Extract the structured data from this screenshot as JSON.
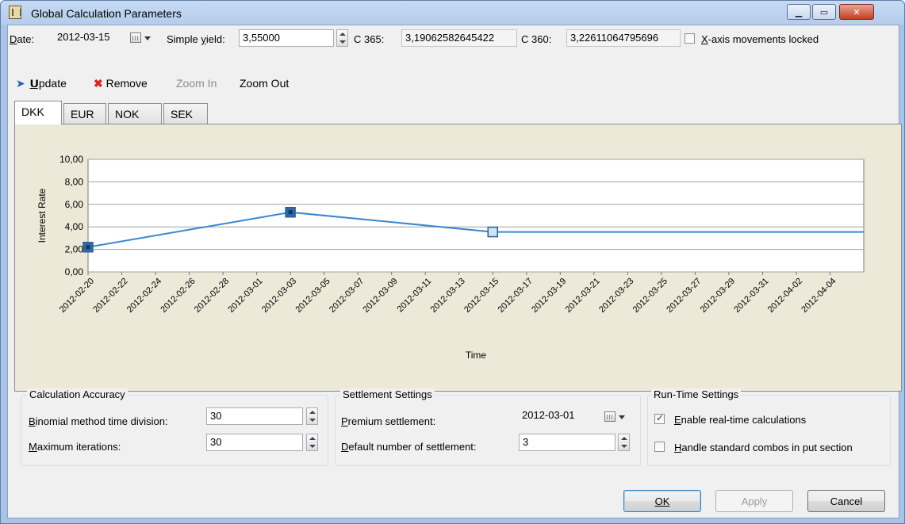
{
  "window": {
    "title": "Global Calculation Parameters"
  },
  "params": {
    "date_label": "Date:",
    "date_value": "2012-03-15",
    "simple_yield_label": "Simple yield:",
    "simple_yield_value": "3,55000",
    "c365_label": "C 365:",
    "c365_value": "3,19062582645422",
    "c360_label": "C 360:",
    "c360_value": "3,22611064795696",
    "xaxis_lock_label": "X-axis movements locked",
    "xaxis_lock_checked": false
  },
  "toolbar": {
    "update_label": "Update",
    "remove_label": "Remove",
    "zoom_in_label": "Zoom In",
    "zoom_out_label": "Zoom Out"
  },
  "tabs": [
    {
      "label": "DKK",
      "active": true
    },
    {
      "label": "EUR",
      "active": false
    },
    {
      "label": "NOK",
      "active": false
    },
    {
      "label": "SEK",
      "active": false
    }
  ],
  "chart_data": {
    "type": "line",
    "xlabel": "Time",
    "ylabel": "Interest Rate",
    "ylim": [
      0,
      10
    ],
    "y_ticks": [
      "0,00",
      "2,00",
      "4,00",
      "6,00",
      "8,00",
      "10,00"
    ],
    "x_ticks": [
      "2012-02-20",
      "2012-02-22",
      "2012-02-24",
      "2012-02-26",
      "2012-02-28",
      "2012-03-01",
      "2012-03-03",
      "2012-03-05",
      "2012-03-07",
      "2012-03-09",
      "2012-03-11",
      "2012-03-13",
      "2012-03-15",
      "2012-03-17",
      "2012-03-19",
      "2012-03-21",
      "2012-03-23",
      "2012-03-25",
      "2012-03-27",
      "2012-03-29",
      "2012-03-31",
      "2012-04-02",
      "2012-04-04"
    ],
    "series": [
      {
        "points": [
          {
            "x": "2012-02-20",
            "y": 2.2
          },
          {
            "x": "2012-03-03",
            "y": 5.3
          },
          {
            "x": "2012-03-15",
            "y": 3.55
          },
          {
            "x": "2012-04-06",
            "y": 3.55
          }
        ]
      }
    ],
    "grid": true,
    "line_color": "#3a86d1"
  },
  "calc_accuracy": {
    "title": "Calculation Accuracy",
    "binomial_label": "Binomial method time division:",
    "binomial_value": "30",
    "max_iter_label": "Maximum iterations:",
    "max_iter_value": "30"
  },
  "settlement": {
    "title": "Settlement Settings",
    "premium_label": "Premium settlement:",
    "premium_value": "2012-03-01",
    "default_num_label": "Default number of settlement:",
    "default_num_value": "3"
  },
  "runtime": {
    "title": "Run-Time Settings",
    "realtime_label": "Enable real-time calculations",
    "realtime_checked": true,
    "combos_label": "Handle standard combos in put section",
    "combos_checked": false
  },
  "buttons": {
    "ok_label": "OK",
    "apply_label": "Apply",
    "cancel_label": "Cancel"
  }
}
